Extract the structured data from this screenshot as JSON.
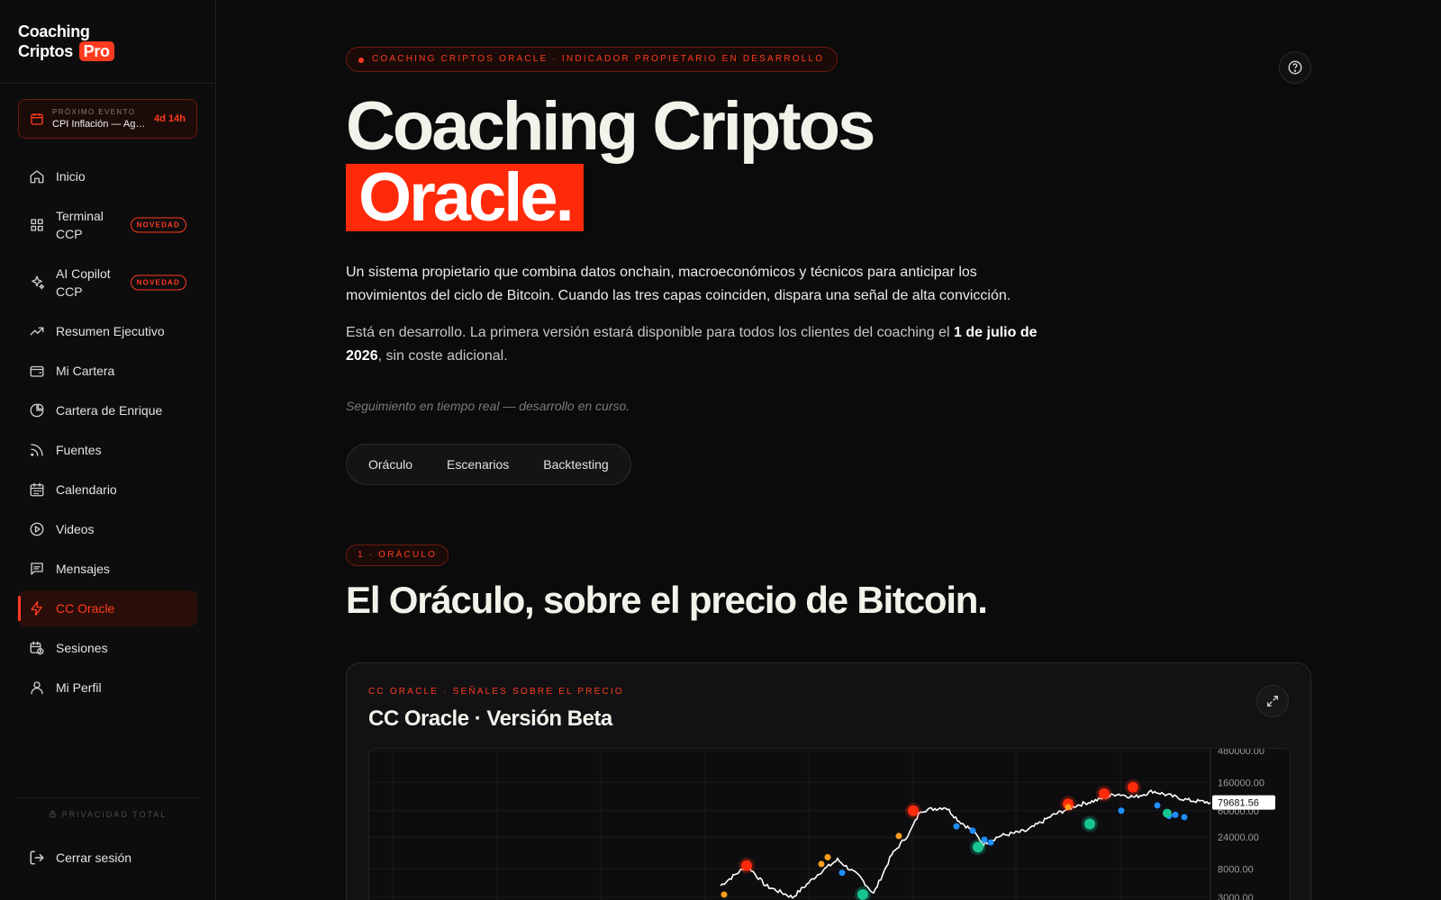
{
  "brand": {
    "line1": "Coaching",
    "line2": "Criptos",
    "pro": "Pro"
  },
  "event": {
    "label": "PRÓXIMO EVENTO",
    "value": "CPI Inflación — Agosto",
    "countdown": "4d 14h"
  },
  "nav": [
    {
      "label": "Inicio",
      "icon": "home-icon"
    },
    {
      "label": "Terminal CCP",
      "icon": "grid-icon",
      "badge": "NOVEDAD"
    },
    {
      "label": "AI Copilot CCP",
      "icon": "sparkles-icon",
      "badge": "NOVEDAD"
    },
    {
      "label": "Resumen Ejecutivo",
      "icon": "trending-up-icon"
    },
    {
      "label": "Mi Cartera",
      "icon": "wallet-icon"
    },
    {
      "label": "Cartera de Enrique",
      "icon": "pie-chart-icon"
    },
    {
      "label": "Fuentes",
      "icon": "rss-icon"
    },
    {
      "label": "Calendario",
      "icon": "calendar-icon"
    },
    {
      "label": "Videos",
      "icon": "play-circle-icon"
    },
    {
      "label": "Mensajes",
      "icon": "message-icon"
    },
    {
      "label": "CC Oracle",
      "icon": "zap-icon",
      "active": true
    },
    {
      "label": "Sesiones",
      "icon": "calendar-clock-icon"
    },
    {
      "label": "Mi Perfil",
      "icon": "user-icon"
    }
  ],
  "privacy": "PRIVACIDAD TOTAL",
  "logout": "Cerrar sesión",
  "hero": {
    "eyebrow": "COACHING CRIPTOS ORACLE · INDICADOR PROPIETARIO EN DESARROLLO",
    "title": "Coaching Criptos",
    "title_highlight": "Oracle.",
    "lead": "Un sistema propietario que combina datos onchain, macroeconómicos y técnicos para anticipar los movimientos del ciclo de Bitcoin. Cuando las tres capas coinciden, dispara una señal de alta convicción.",
    "lead2_pre": "Está en desarrollo. La primera versión estará disponible para todos los clientes del coaching el ",
    "lead2_bold": "1 de julio de 2026",
    "lead2_post": ", sin coste adicional.",
    "note": "Seguimiento en tiempo real — desarrollo en curso."
  },
  "tabs": [
    "Oráculo",
    "Escenarios",
    "Backtesting"
  ],
  "section": {
    "pill": "1 · ORÁCULO",
    "title": "El Oráculo, sobre el precio de Bitcoin."
  },
  "card": {
    "caption": "CC ORACLE · SEÑALES SOBRE EL PRECIO",
    "title": "CC Oracle · Versión Beta"
  },
  "chart_data": {
    "type": "line",
    "scale": "log",
    "y_ticks": [
      480000,
      160000,
      60000,
      24000,
      8000,
      3000
    ],
    "y_tick_labels": [
      "480000.00",
      "160000.00",
      "60000.00",
      "24000.00",
      "8000.00",
      "3000.00"
    ],
    "last_price_label": "79681.56",
    "series_color": "#ffffff",
    "signal_colors": {
      "red": "#ff2a0a",
      "orange": "#ff9f1a",
      "blue": "#1f8fff",
      "green": "#18c48f"
    }
  }
}
